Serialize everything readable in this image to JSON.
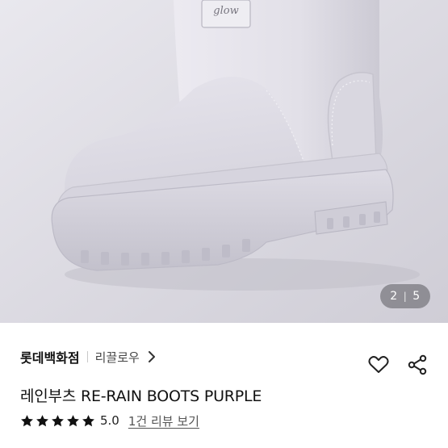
{
  "gallery": {
    "image_alt": "purple rain boot product photo",
    "logo_text": "glow",
    "current": "2",
    "separator": "|",
    "total": "5"
  },
  "seller": {
    "store_name": "롯데백화점",
    "brand_name": "리끌로우",
    "chevron_icon": "chevron-right-icon"
  },
  "actions": {
    "wishlist_icon": "heart-outline-icon",
    "share_icon": "share-icon"
  },
  "product": {
    "title": "레인부츠 RE-RAIN BOOTS PURPLE"
  },
  "rating": {
    "stars_filled": 5,
    "stars_total": 5,
    "score": "5.0",
    "review_link": "1건 리뷰 보기"
  },
  "colors": {
    "boot": "#e4e2ea",
    "background": "#d8d6de",
    "text": "#111111"
  }
}
